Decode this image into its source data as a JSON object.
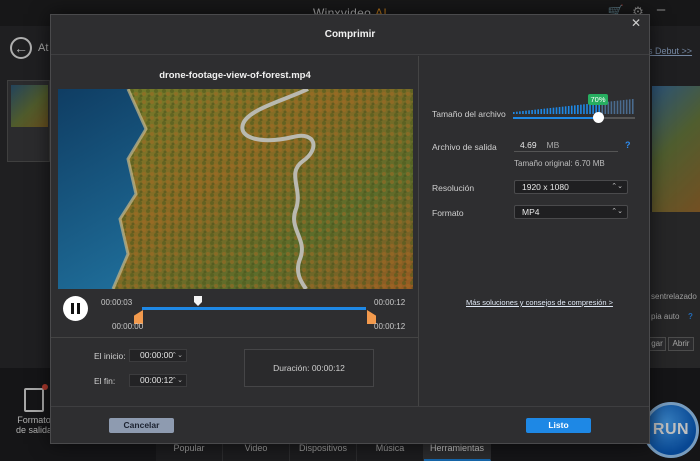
{
  "app": {
    "title_main": "Winxvideo",
    "title_ai": "AI",
    "back_label": "At",
    "debut_link": "s Debut >>",
    "output_format_label": "Formato de salida",
    "run_label": "RUN",
    "tabs": [
      {
        "label": "Popular"
      },
      {
        "label": "Video"
      },
      {
        "label": "Dispositivos"
      },
      {
        "label": "Música"
      },
      {
        "label": "Herramientas"
      }
    ],
    "side_options": {
      "deinterlace": "sentrelazado",
      "copy_auto": "pia auto",
      "add_btn": "gar",
      "open_btn": "Abrir"
    }
  },
  "dialog": {
    "title": "Comprimir",
    "file_name": "drone-footage-view-of-forest.mp4",
    "playback": {
      "current_time": "00:00:03",
      "end_time": "00:00:12",
      "trim_start": "00:00:00",
      "trim_end": "00:00:12",
      "progress": 0.25
    },
    "trim": {
      "start_label": "El inicio:",
      "start_value": "00:00:00",
      "end_label": "El fin:",
      "end_value": "00:00:12",
      "duration_text": "Duración:  00:00:12"
    },
    "settings": {
      "file_size_label": "Tamaño del archivo",
      "size_percent": 70,
      "size_percent_text": "70%",
      "output_file_label": "Archivo de salida",
      "output_size_value": "4.69",
      "output_size_unit": "MB",
      "original_size_text": "Tamaño original: 6.70 MB",
      "resolution_label": "Resolución",
      "resolution_value": "1920 x 1080",
      "format_label": "Formato",
      "format_value": "MP4",
      "more_link": "Más soluciones y consejos de compresión >"
    },
    "buttons": {
      "cancel": "Cancelar",
      "ok": "Listo"
    }
  },
  "colors": {
    "accent": "#1e88e5",
    "ai_orange": "#f29a22",
    "badge_green": "#27ae60",
    "trim_orange": "#f39a4d"
  }
}
